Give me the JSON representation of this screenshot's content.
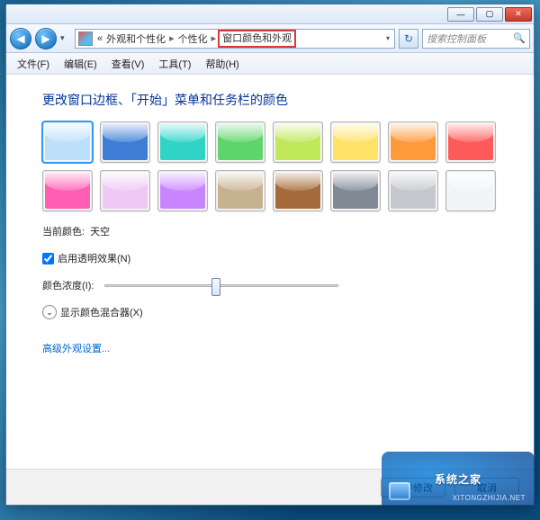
{
  "titlebar": {
    "min": "—",
    "max": "▢",
    "close": "✕"
  },
  "nav": {
    "back_glyph": "◀",
    "fwd_glyph": "▶",
    "chevron": "«",
    "crumb1": "外观和个性化",
    "crumb2": "个性化",
    "crumb3": "窗口颜色和外观",
    "arrow": "▸",
    "dropdown": "▾",
    "refresh_glyph": "↻",
    "search_placeholder": "搜索控制面板",
    "search_glyph": "🔍"
  },
  "menu": {
    "file": "文件(F)",
    "edit": "编辑(E)",
    "view": "查看(V)",
    "tools": "工具(T)",
    "help": "帮助(H)"
  },
  "heading": "更改窗口边框、「开始」菜单和任务栏的颜色",
  "swatches": [
    {
      "name": "天空",
      "hex": "#bcdffb",
      "selected": true
    },
    {
      "name": "blue",
      "hex": "#3d7dd6"
    },
    {
      "name": "teal",
      "hex": "#2fd4c7"
    },
    {
      "name": "leaf",
      "hex": "#5fd46b"
    },
    {
      "name": "lime",
      "hex": "#c1e75a"
    },
    {
      "name": "sun",
      "hex": "#ffe366"
    },
    {
      "name": "pumpkin",
      "hex": "#ff9a3c"
    },
    {
      "name": "ruby",
      "hex": "#ff5a5a"
    },
    {
      "name": "fuchsia",
      "hex": "#ff5fb3"
    },
    {
      "name": "lavender",
      "hex": "#efc8f4"
    },
    {
      "name": "violet",
      "hex": "#c985ff"
    },
    {
      "name": "taupe",
      "hex": "#c7b28f"
    },
    {
      "name": "chocolate",
      "hex": "#a56b3a"
    },
    {
      "name": "slate",
      "hex": "#7f8a95"
    },
    {
      "name": "graphite",
      "hex": "#c4c8cd"
    },
    {
      "name": "frost",
      "hex": "#f2f5f7"
    }
  ],
  "current_label": "当前颜色:",
  "current_value": "天空",
  "transparency_label": "启用透明效果(N)",
  "transparency_checked": true,
  "intensity_label": "颜色浓度(I):",
  "mixer_label": "显示颜色混合器(X)",
  "mixer_glyph": "⌄",
  "advanced_link": "高级外观设置...",
  "footer": {
    "save": "保存修改",
    "cancel": "取消"
  },
  "watermark": {
    "brand": "系统之家",
    "url": "XITONGZHIJIA.NET"
  }
}
